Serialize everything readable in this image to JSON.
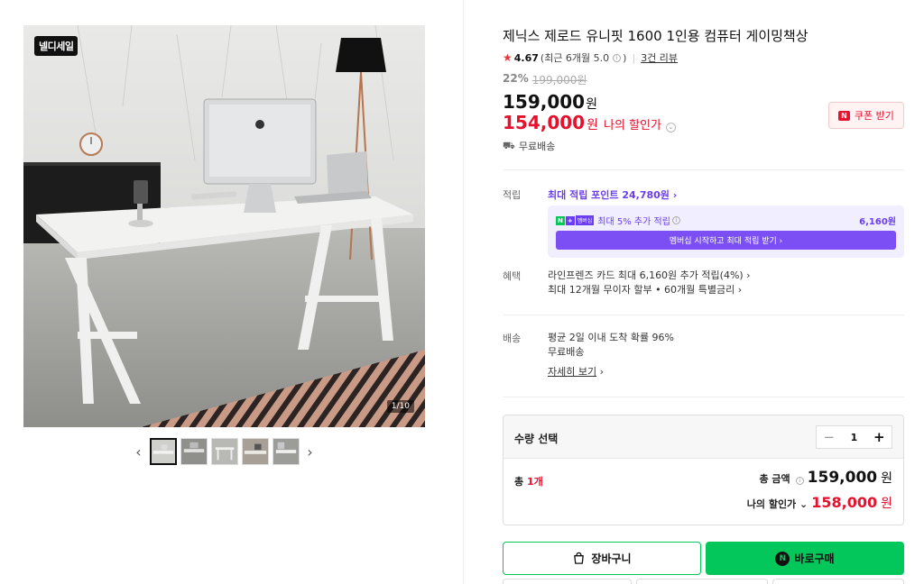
{
  "gallery": {
    "logo_badge": "넬디세일",
    "image_counter": "1/10",
    "prev_label": "‹",
    "next_label": "›",
    "thumb_count": 5
  },
  "product": {
    "title": "제닉스 제로드 유니핏 1600 1인용 컴퓨터 게이밍책상",
    "rating": "4.67",
    "rating_detail": "(최근 6개월 5.0",
    "rating_detail_close": ")",
    "review_count": "3건 리뷰",
    "discount_pct": "22%",
    "original_price": "199,000원",
    "price": "159,000",
    "price_unit": "원",
    "my_price": "154,000",
    "my_price_unit": "원",
    "my_discount_label": "나의 할인가",
    "coupon_label": "쿠폰 받기",
    "coupon_icon": "N",
    "shipping": "무료배송"
  },
  "points": {
    "label": "적립",
    "max_points": "최대 적립 포인트 24,780원 ›",
    "member_n": "N",
    "member_plus": "+",
    "member_tag": "멤버십",
    "member_text": "최대 5% 추가 적립",
    "member_amount": "6,160원",
    "member_button": "멤버십 시작하고 최대 적립 받기 ›"
  },
  "benefits": {
    "label": "혜택",
    "line1": "라인프렌즈 카드 최대 6,160원 추가 적립(4%) ›",
    "line2": "최대 12개월 무이자 할부 • 60개월 특별금리 ›"
  },
  "delivery": {
    "label": "배송",
    "line1": "평균 2일 이내 도착 확률 96%",
    "line2": "무료배송",
    "detail_link": "자세히 보기",
    "detail_arrow": "›"
  },
  "quantity": {
    "label": "수량 선택",
    "value": "1",
    "minus": "−",
    "plus": "+",
    "total_prefix": "총 ",
    "total_count": "1개",
    "total_label": "총 금액",
    "total_value": "159,000",
    "total_unit": "원",
    "mydisc_label": "나의 할인가 ⌄",
    "mydisc_value": "158,000",
    "mydisc_unit": "원"
  },
  "actions": {
    "cart_label": "장바구니",
    "buy_label": "바로구매",
    "npay_icon": "N"
  },
  "colors": {
    "accent_red": "#e5112d",
    "naver_green": "#03c75a",
    "membership_purple": "#6b3df1"
  }
}
